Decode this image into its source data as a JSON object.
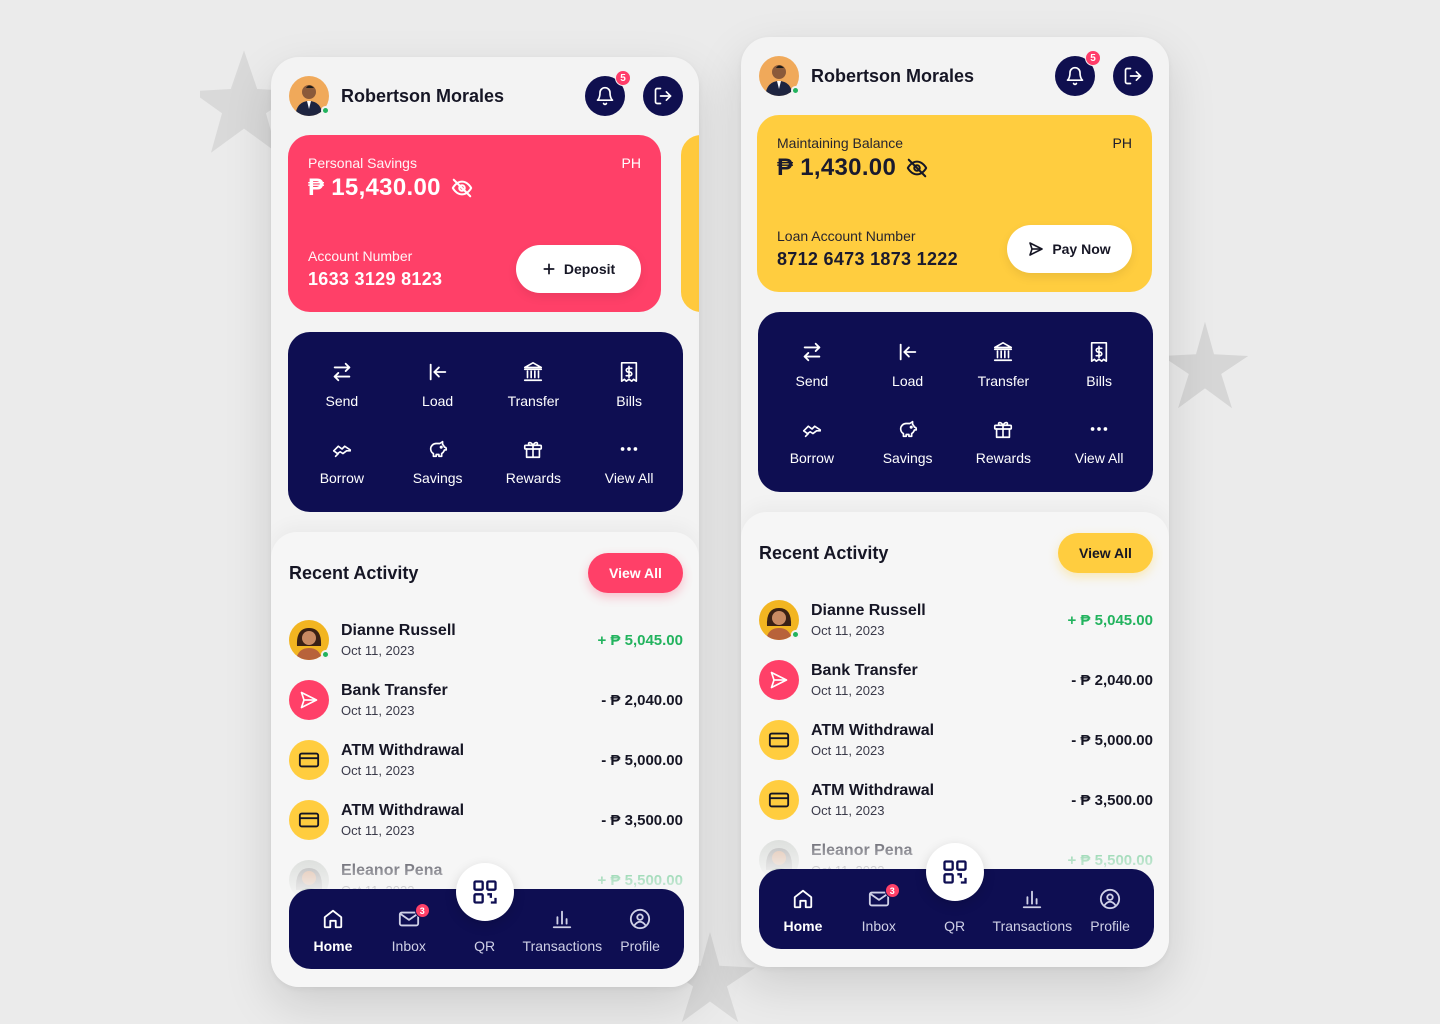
{
  "colors": {
    "navy": "#0e0e52",
    "pink": "#ff4068",
    "yellow": "#ffcd3f",
    "positive": "#22b35e",
    "background": "#ebebeb"
  },
  "screens": [
    {
      "user": {
        "name": "Robertson Morales",
        "notification_count": "5"
      },
      "card": {
        "label": "Personal Savings",
        "region": "PH",
        "amount": "₱ 15,430.00",
        "account_label": "Account Number",
        "account_number": "1633 3129 8123",
        "button_label": "Deposit",
        "button_icon": "plus-icon"
      },
      "actions": [
        {
          "label": "Send",
          "icon": "send-arrows-icon"
        },
        {
          "label": "Load",
          "icon": "load-icon"
        },
        {
          "label": "Transfer",
          "icon": "bank-icon"
        },
        {
          "label": "Bills",
          "icon": "receipt-icon"
        },
        {
          "label": "Borrow",
          "icon": "handshake-icon"
        },
        {
          "label": "Savings",
          "icon": "piggy-bank-icon"
        },
        {
          "label": "Rewards",
          "icon": "gift-icon"
        },
        {
          "label": "View All",
          "icon": "more-icon"
        }
      ],
      "recent": {
        "title": "Recent Activity",
        "view_all": "View All",
        "transactions": [
          {
            "name": "Dianne Russell",
            "date": "Oct 11, 2023",
            "amount": "+ ₱ 5,045.00"
          },
          {
            "name": "Bank Transfer",
            "date": "Oct 11, 2023",
            "amount": "- ₱ 2,040.00"
          },
          {
            "name": "ATM Withdrawal",
            "date": "Oct 11, 2023",
            "amount": "- ₱ 5,000.00"
          },
          {
            "name": "ATM Withdrawal",
            "date": "Oct 11, 2023",
            "amount": "- ₱ 3,500.00"
          },
          {
            "name": "Eleanor Pena",
            "date": "Oct 11, 2023",
            "amount": "+ ₱ 5,500.00"
          }
        ]
      },
      "nav": {
        "home": "Home",
        "inbox": "Inbox",
        "inbox_badge": "3",
        "qr": "QR",
        "transactions": "Transactions",
        "profile": "Profile"
      }
    },
    {
      "user": {
        "name": "Robertson Morales",
        "notification_count": "5"
      },
      "card": {
        "label": "Maintaining Balance",
        "region": "PH",
        "amount": "₱ 1,430.00",
        "account_label": "Loan Account Number",
        "account_number": "8712 6473 1873 1222",
        "button_label": "Pay Now",
        "button_icon": "paper-plane-icon"
      },
      "actions": [
        {
          "label": "Send",
          "icon": "send-arrows-icon"
        },
        {
          "label": "Load",
          "icon": "load-icon"
        },
        {
          "label": "Transfer",
          "icon": "bank-icon"
        },
        {
          "label": "Bills",
          "icon": "receipt-icon"
        },
        {
          "label": "Borrow",
          "icon": "handshake-icon"
        },
        {
          "label": "Savings",
          "icon": "piggy-bank-icon"
        },
        {
          "label": "Rewards",
          "icon": "gift-icon"
        },
        {
          "label": "View All",
          "icon": "more-icon"
        }
      ],
      "recent": {
        "title": "Recent Activity",
        "view_all": "View All",
        "transactions": [
          {
            "name": "Dianne Russell",
            "date": "Oct 11, 2023",
            "amount": "+ ₱ 5,045.00"
          },
          {
            "name": "Bank Transfer",
            "date": "Oct 11, 2023",
            "amount": "- ₱ 2,040.00"
          },
          {
            "name": "ATM Withdrawal",
            "date": "Oct 11, 2023",
            "amount": "- ₱ 5,000.00"
          },
          {
            "name": "ATM Withdrawal",
            "date": "Oct 11, 2023",
            "amount": "- ₱ 3,500.00"
          },
          {
            "name": "Eleanor Pena",
            "date": "Oct 11, 2023",
            "amount": "+ ₱ 5,500.00"
          }
        ]
      },
      "nav": {
        "home": "Home",
        "inbox": "Inbox",
        "inbox_badge": "3",
        "qr": "QR",
        "transactions": "Transactions",
        "profile": "Profile"
      }
    }
  ]
}
